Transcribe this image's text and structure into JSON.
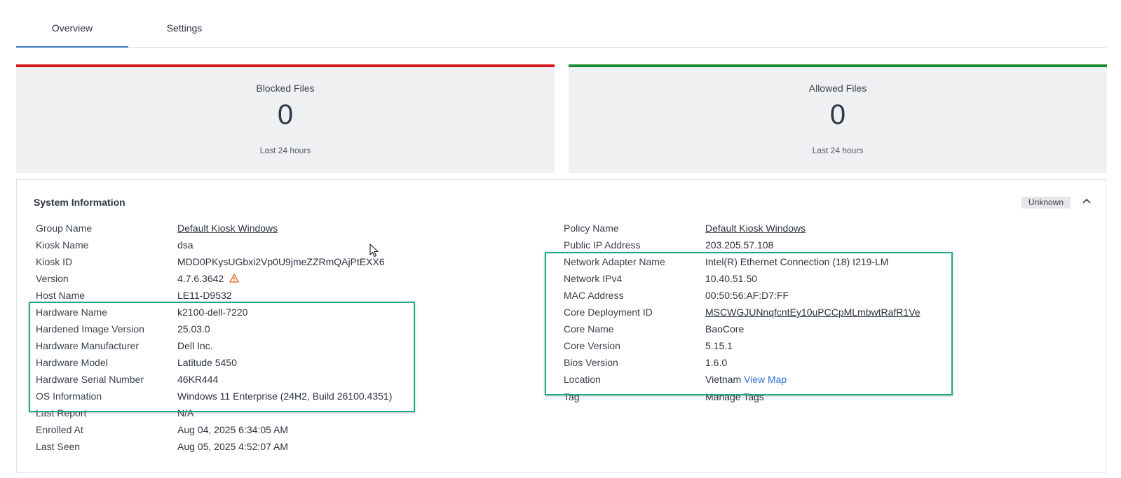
{
  "tabs": [
    {
      "label": "Overview",
      "active": true
    },
    {
      "label": "Settings",
      "active": false
    }
  ],
  "cards": {
    "blocked": {
      "title": "Blocked Files",
      "value": "0",
      "sub": "Last 24 hours",
      "accent": "#d31b1b"
    },
    "allowed": {
      "title": "Allowed Files",
      "value": "0",
      "sub": "Last 24 hours",
      "accent": "#1c8a2e"
    }
  },
  "system_info": {
    "title": "System Information",
    "status": "Unknown",
    "toggle_icon": "chevron-up-icon",
    "left": {
      "group_name": {
        "label": "Group Name",
        "value": "Default Kiosk Windows"
      },
      "kiosk_name": {
        "label": "Kiosk Name",
        "value": "dsa"
      },
      "kiosk_id": {
        "label": "Kiosk ID",
        "value": "MDD0PKysUGbxi2Vp0U9jmeZZRmQAjPtEXX6"
      },
      "version": {
        "label": "Version",
        "value": "4.7.6.3642",
        "warning_icon": "warning-triangle-icon"
      },
      "host_name": {
        "label": "Host Name",
        "value": "LE11-D9532"
      },
      "hardware_name": {
        "label": "Hardware Name",
        "value": "k2100-dell-7220"
      },
      "hardened_image_version": {
        "label": "Hardened Image Version",
        "value": "25.03.0"
      },
      "hardware_manufacturer": {
        "label": "Hardware Manufacturer",
        "value": "Dell Inc."
      },
      "hardware_model": {
        "label": "Hardware Model",
        "value": "Latitude 5450"
      },
      "hardware_serial_number": {
        "label": "Hardware Serial Number",
        "value": "46KR444"
      },
      "os_information": {
        "label": "OS Information",
        "value": "Windows 11 Enterprise (24H2, Build 26100.4351)"
      },
      "last_report": {
        "label": "Last Report",
        "value": "N/A"
      },
      "enrolled_at": {
        "label": "Enrolled At",
        "value": "Aug 04, 2025 6:34:05 AM"
      },
      "last_seen": {
        "label": "Last Seen",
        "value": "Aug 05, 2025 4:52:07 AM"
      }
    },
    "right": {
      "policy_name": {
        "label": "Policy Name",
        "value": "Default Kiosk Windows"
      },
      "public_ip": {
        "label": "Public IP Address",
        "value": "203.205.57.108"
      },
      "network_adapter": {
        "label": "Network Adapter Name",
        "value": "Intel(R) Ethernet Connection (18) I219-LM"
      },
      "network_ipv4": {
        "label": "Network IPv4",
        "value": "10.40.51.50"
      },
      "mac_address": {
        "label": "MAC Address",
        "value": "00:50:56:AF:D7:FF"
      },
      "core_deployment_id": {
        "label": "Core Deployment ID",
        "value": "MSCWGJUNnqfcntEy10uPCCpMLmbwtRafR1Ve"
      },
      "core_name": {
        "label": "Core Name",
        "value": "BaoCore"
      },
      "core_version": {
        "label": "Core Version",
        "value": "5.15.1"
      },
      "bios_version": {
        "label": "Bios Version",
        "value": "1.6.0"
      },
      "location": {
        "label": "Location",
        "value": "Vietnam",
        "link": "View Map"
      },
      "tag": {
        "label": "Tag",
        "value": "Manage Tags"
      }
    }
  },
  "colors": {
    "highlight": "#1ea98a",
    "link": "#2f6fd1",
    "warning": "#e05a12"
  }
}
